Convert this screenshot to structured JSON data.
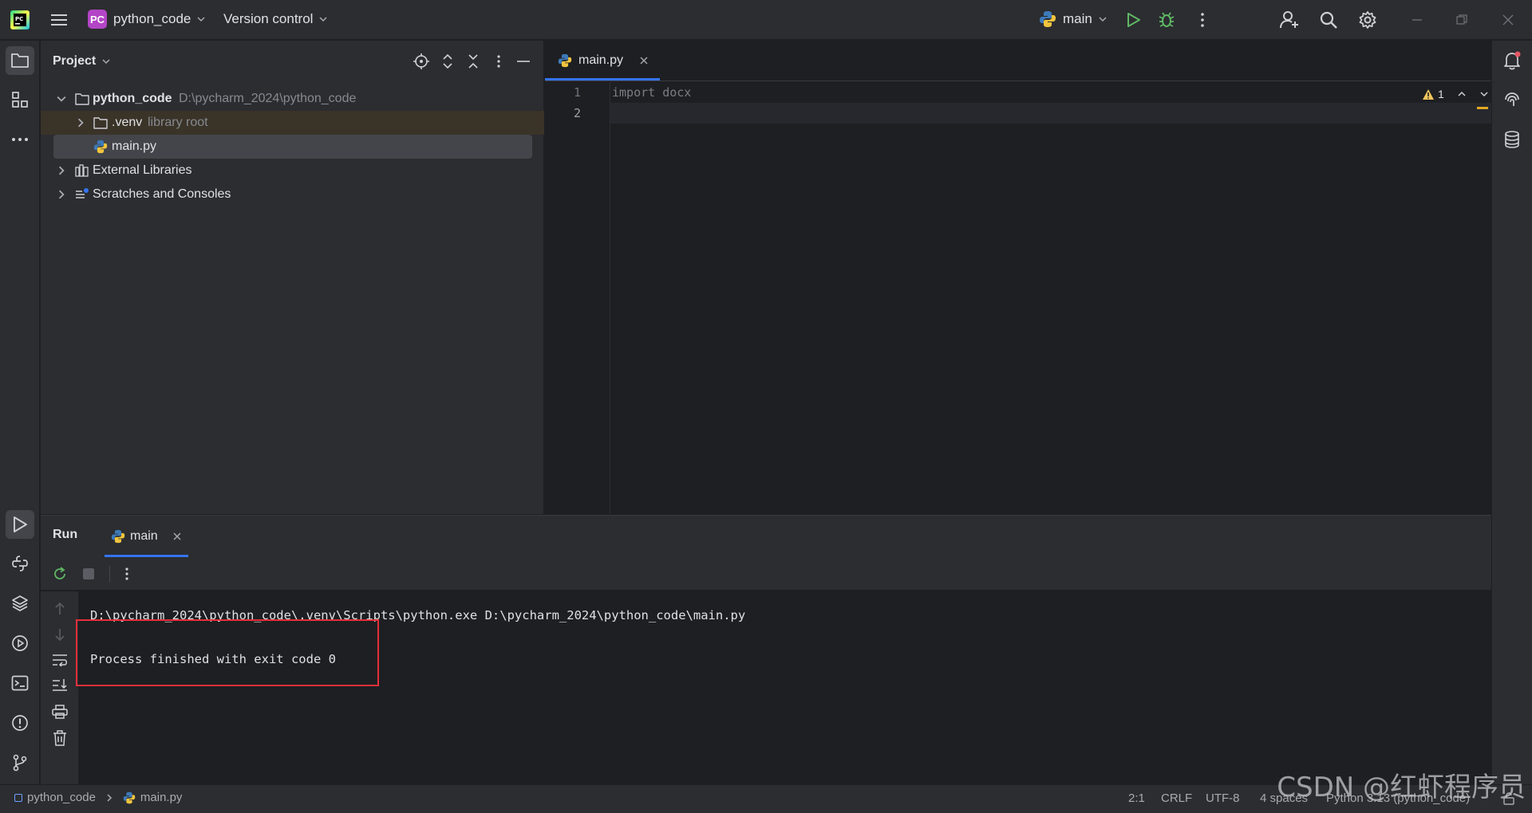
{
  "titlebar": {
    "app_logo": "pycharm-logo",
    "project_badge": "PC",
    "project_badge_color": "#b345c6",
    "project_name": "python_code",
    "vcs_label": "Version control",
    "run_config": "main"
  },
  "project_panel": {
    "title": "Project",
    "tree": {
      "root_name": "python_code",
      "root_path": "D:\\pycharm_2024\\python_code",
      "venv_name": ".venv",
      "venv_hint": "library root",
      "file_name": "main.py",
      "ext_libs": "External Libraries",
      "scratches": "Scratches and Consoles"
    }
  },
  "editor": {
    "tab_label": "main.py",
    "line_numbers": [
      "1",
      "2"
    ],
    "code_lines": [
      "import docx",
      ""
    ],
    "warning_count": "1"
  },
  "run_panel": {
    "title": "Run",
    "tab_label": "main",
    "console_command": "D:\\pycharm_2024\\python_code\\.venv\\Scripts\\python.exe D:\\pycharm_2024\\python_code\\main.py",
    "console_result": "Process finished with exit code 0"
  },
  "statusbar": {
    "crumb_project": "python_code",
    "crumb_file": "main.py",
    "position": "2:1",
    "line_sep": "CRLF",
    "encoding": "UTF-8",
    "indent": "4 spaces",
    "interpreter": "Python 3.13 (python_code)"
  },
  "watermark": "CSDN @红虾程序员",
  "colors": {
    "accent": "#3574f0",
    "run_green": "#5fb865",
    "highlight_red": "#e5303a",
    "python_blue": "#3d7ab8",
    "python_yellow": "#f0c43e"
  }
}
